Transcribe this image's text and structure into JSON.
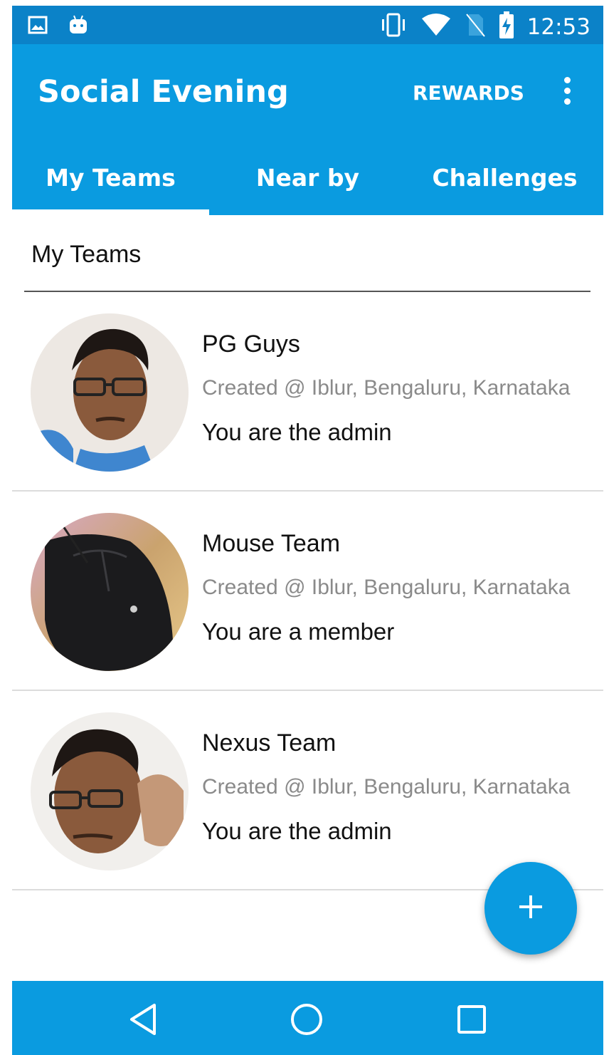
{
  "status_bar": {
    "time": "12:53",
    "left_icons": [
      "image-icon",
      "android-icon"
    ],
    "right_icons": [
      "vibrate-icon",
      "wifi-icon",
      "no-sim-icon",
      "battery-charging-icon"
    ]
  },
  "app_bar": {
    "title": "Social Evening",
    "action_label": "REWARDS",
    "overflow_icon": "more-vert-icon"
  },
  "tabs": [
    {
      "label": "My Teams",
      "selected": true
    },
    {
      "label": "Near by",
      "selected": false
    },
    {
      "label": "Challenges",
      "selected": false
    }
  ],
  "section": {
    "title": "My Teams"
  },
  "teams": [
    {
      "name": "PG Guys",
      "location": "Created @ Iblur, Bengaluru, Karnataka",
      "role": "You are the admin"
    },
    {
      "name": "Mouse Team",
      "location": "Created @ Iblur, Bengaluru, Karnataka",
      "role": "You are a member"
    },
    {
      "name": "Nexus Team",
      "location": "Created @ Iblur, Bengaluru, Karnataka",
      "role": "You are the admin"
    }
  ],
  "fab": {
    "icon": "add-icon"
  },
  "nav_bar": {
    "icons": [
      "back-icon",
      "home-icon",
      "recents-icon"
    ]
  },
  "colors": {
    "primary": "#0a9be0",
    "primary_dark": "#0b82c8",
    "secondary_text": "#8a8a8a"
  }
}
